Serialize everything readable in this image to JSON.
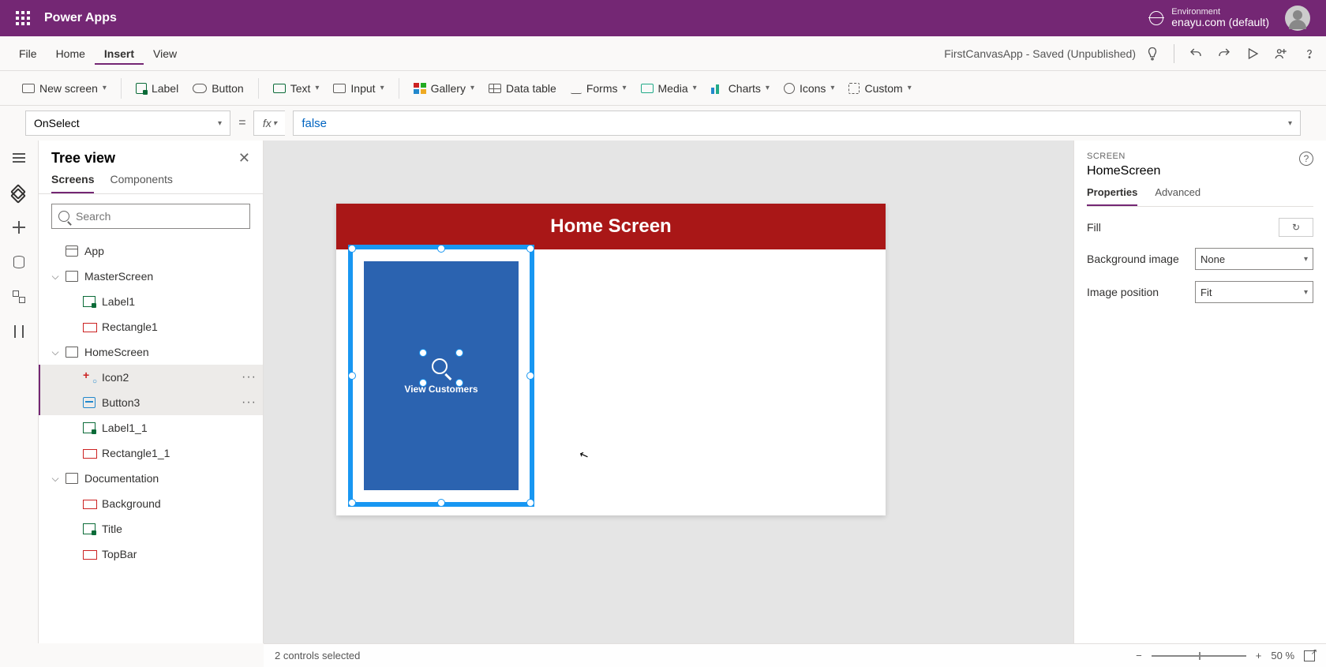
{
  "header": {
    "app_name": "Power Apps",
    "env_label": "Environment",
    "env_name": "enayu.com (default)"
  },
  "menu": {
    "file": "File",
    "home": "Home",
    "insert": "Insert",
    "view": "View",
    "status": "FirstCanvasApp - Saved (Unpublished)"
  },
  "ribbon": {
    "new_screen": "New screen",
    "label": "Label",
    "button": "Button",
    "text": "Text",
    "input": "Input",
    "gallery": "Gallery",
    "data_table": "Data table",
    "forms": "Forms",
    "media": "Media",
    "charts": "Charts",
    "icons": "Icons",
    "custom": "Custom"
  },
  "formula": {
    "property": "OnSelect",
    "fx_label": "fx",
    "value": "false"
  },
  "tree": {
    "title": "Tree view",
    "tab_screens": "Screens",
    "tab_components": "Components",
    "search_placeholder": "Search",
    "app": "App",
    "master": "MasterScreen",
    "label1": "Label1",
    "rect1": "Rectangle1",
    "home": "HomeScreen",
    "icon2": "Icon2",
    "button3": "Button3",
    "label1_1": "Label1_1",
    "rect1_1": "Rectangle1_1",
    "documentation": "Documentation",
    "background": "Background",
    "title_node": "Title",
    "topbar": "TopBar"
  },
  "canvas": {
    "title": "Home Screen",
    "card_label": "View Customers"
  },
  "props": {
    "type": "SCREEN",
    "name": "HomeScreen",
    "tab_properties": "Properties",
    "tab_advanced": "Advanced",
    "fill": "Fill",
    "bg_image": "Background image",
    "bg_value": "None",
    "img_pos": "Image position",
    "img_pos_value": "Fit"
  },
  "status": {
    "selection": "2 controls selected",
    "zoom": "50",
    "zoom_unit": "%"
  }
}
